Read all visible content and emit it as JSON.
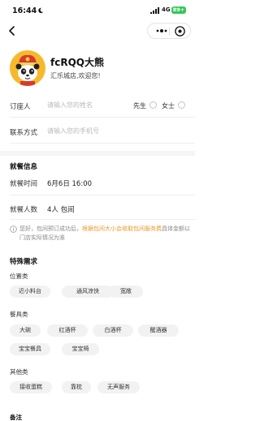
{
  "status_bar": {
    "time": "16:44",
    "network": "4G",
    "battery": "89+"
  },
  "store": {
    "name": "fcRQQ大熊",
    "welcome": "汇乐城店,欢迎您!"
  },
  "form": {
    "booker_label": "订座人",
    "name_placeholder": "请输入您的姓名",
    "gender_options": [
      "先生",
      "女士"
    ],
    "contact_label": "联系方式",
    "phone_placeholder": "请输入您的手机号"
  },
  "dining": {
    "section_title": "就餐信息",
    "time_label": "就餐时间",
    "time_value": "6月6日 16:00",
    "people_label": "就餐人数",
    "people_value": "4人 包间",
    "notice_before": "您好，包间预订成功后，",
    "notice_link": "根据包间大小会收取包间服务费",
    "notice_after": "具体金额以门店实际情况为准"
  },
  "special": {
    "section_title": "特殊需求",
    "categories": [
      {
        "label": "位置类",
        "options": [
          "近小料台",
          "通风凉快",
          "宽敞"
        ]
      },
      {
        "label": "餐具类",
        "options": [
          "大碗",
          "红酒杯",
          "白酒杯",
          "醒酒器",
          "宝宝餐具",
          "宝宝椅"
        ]
      },
      {
        "label": "其他类",
        "options": [
          "接收蛋糕",
          "靠枕",
          "无声服务"
        ]
      }
    ]
  },
  "remark_label": "备注",
  "colors": {
    "accent_orange": "#e89a2a",
    "chip_bg": "#f2f2f2",
    "battery_green": "#34c759"
  }
}
